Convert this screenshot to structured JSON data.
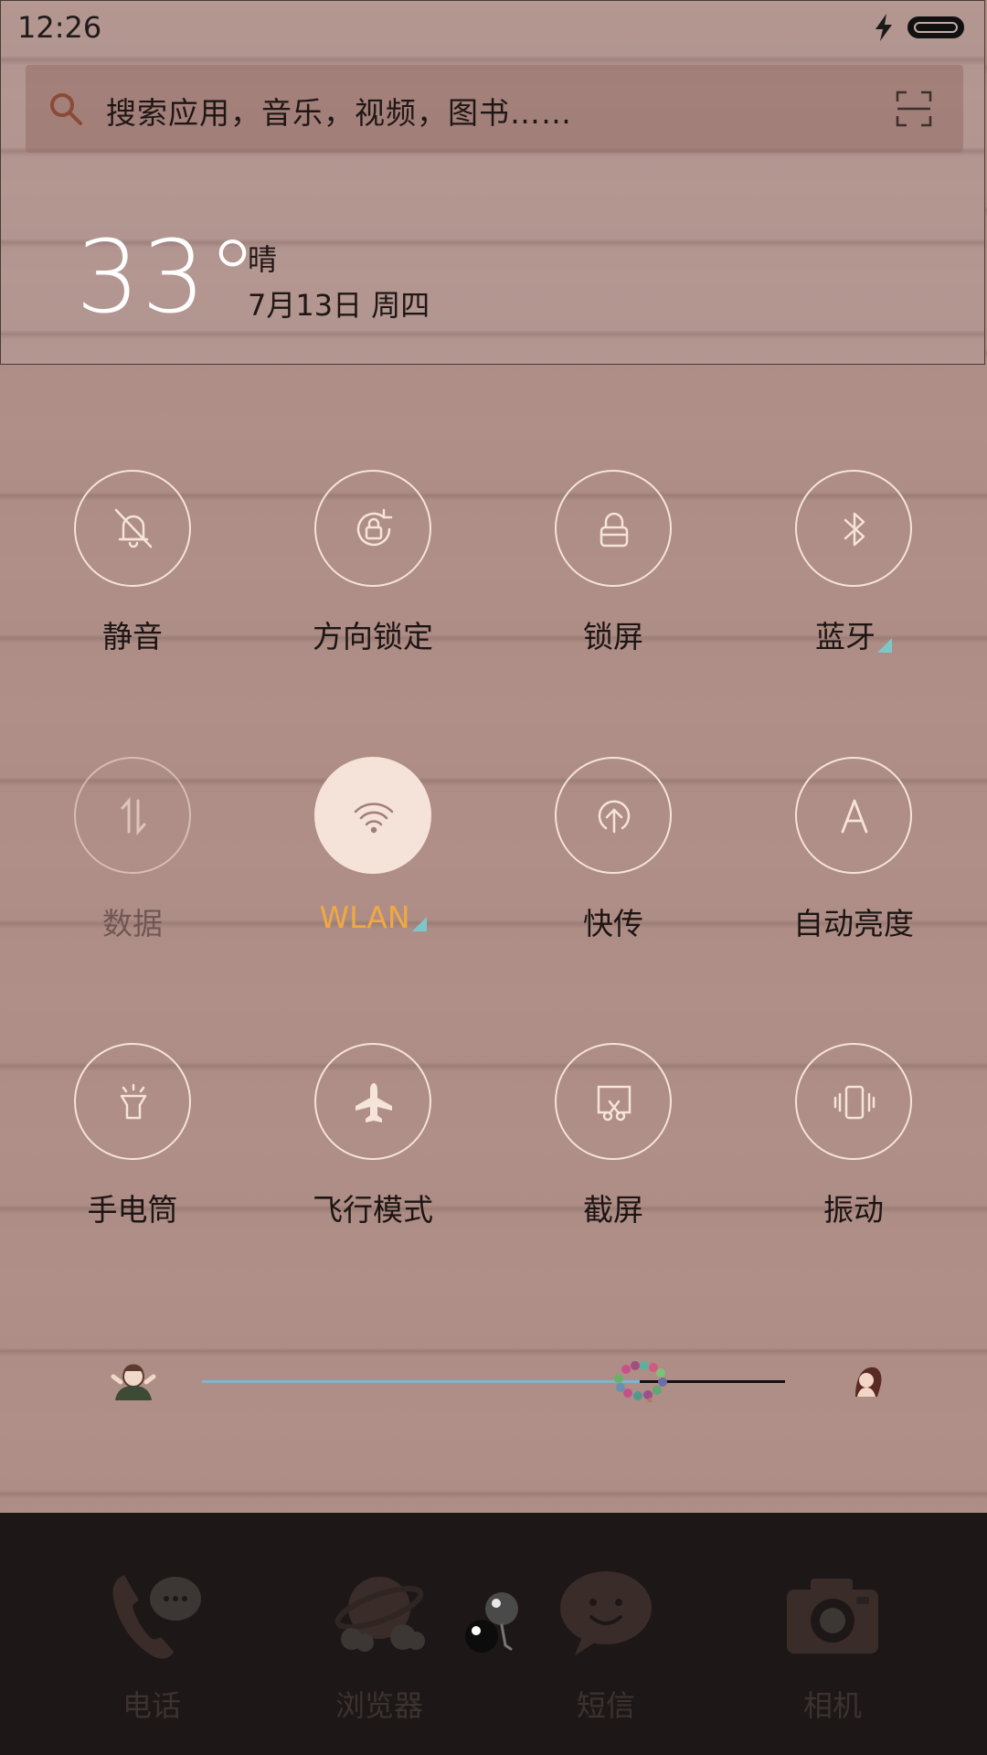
{
  "status": {
    "time": "12:26",
    "icons": [
      "charging-icon",
      "battery-icon"
    ]
  },
  "search": {
    "placeholder": "搜索应用，音乐，视频，图书……",
    "icons": [
      "search-icon",
      "scan-icon"
    ]
  },
  "weather": {
    "temp": "33°",
    "condition": "晴",
    "date": "7月13日 周四"
  },
  "toggles": [
    {
      "label": "静音",
      "icon": "bell-off-icon",
      "state": "off"
    },
    {
      "label": "方向锁定",
      "icon": "rotation-lock-icon",
      "state": "off"
    },
    {
      "label": "锁屏",
      "icon": "lock-icon",
      "state": "off"
    },
    {
      "label": "蓝牙",
      "icon": "bluetooth-icon",
      "state": "off",
      "expandable": true
    },
    {
      "label": "数据",
      "icon": "mobile-data-icon",
      "state": "disabled"
    },
    {
      "label": "WLAN",
      "icon": "wifi-icon",
      "state": "on",
      "expandable": true
    },
    {
      "label": "快传",
      "icon": "quick-transfer-icon",
      "state": "off"
    },
    {
      "label": "自动亮度",
      "icon": "auto-brightness-icon",
      "state": "off"
    },
    {
      "label": "手电筒",
      "icon": "flashlight-icon",
      "state": "off"
    },
    {
      "label": "飞行模式",
      "icon": "airplane-icon",
      "state": "off"
    },
    {
      "label": "截屏",
      "icon": "screenshot-icon",
      "state": "off"
    },
    {
      "label": "振动",
      "icon": "vibrate-icon",
      "state": "off"
    }
  ],
  "brightness": {
    "level": 0.75
  },
  "dock": [
    {
      "label": "电话",
      "icon": "phone-icon"
    },
    {
      "label": "浏览器",
      "icon": "browser-icon"
    },
    {
      "label": "短信",
      "icon": "message-icon"
    },
    {
      "label": "相机",
      "icon": "camera-icon"
    }
  ],
  "colors": {
    "accent": "#f0a941",
    "active_tile": "#f5e2d8",
    "expand_marker": "#7cc8c8",
    "slider_fill": "#7eb6cc"
  }
}
